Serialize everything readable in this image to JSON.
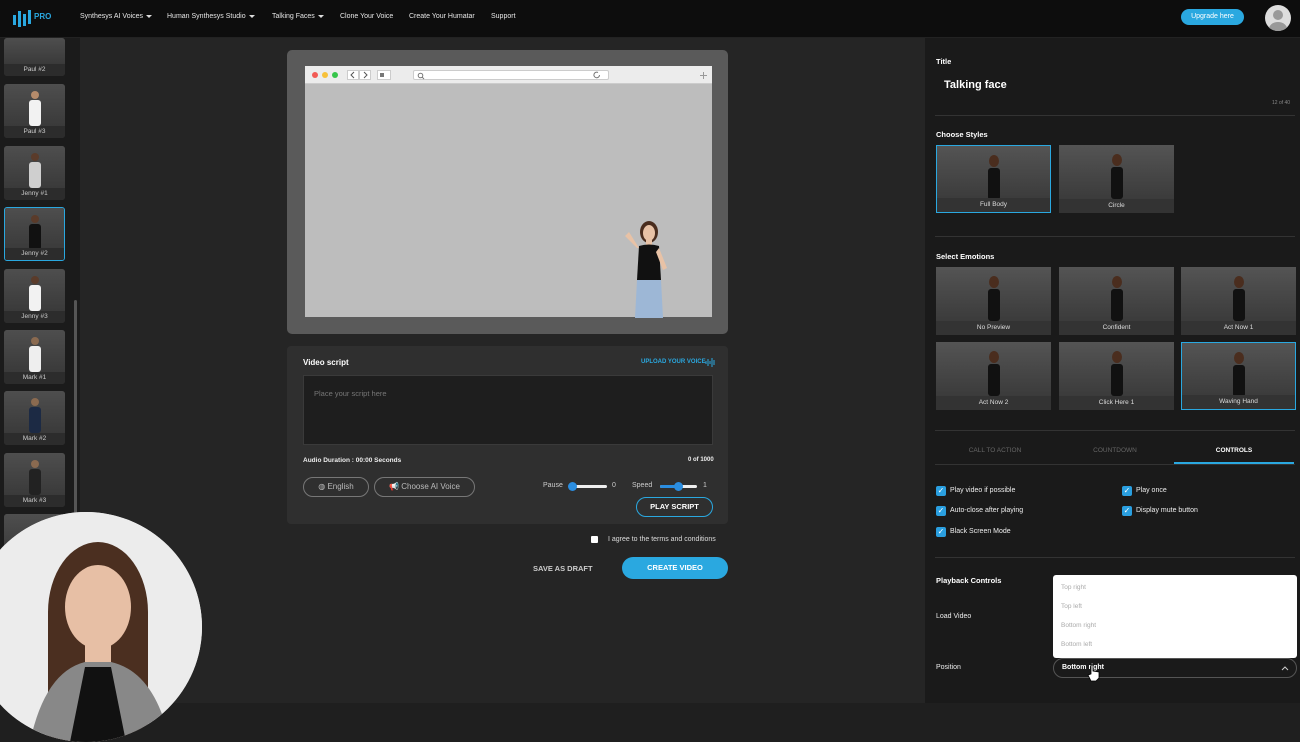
{
  "nav": {
    "logo_badge": "PRO",
    "items": [
      {
        "label": "Synthesys AI Voices",
        "caret": true
      },
      {
        "label": "Human Synthesys Studio",
        "caret": true
      },
      {
        "label": "Talking Faces",
        "caret": true
      },
      {
        "label": "Clone Your Voice",
        "caret": false
      },
      {
        "label": "Create Your Humatar",
        "caret": false
      },
      {
        "label": "Support",
        "caret": false
      }
    ],
    "upgrade_label": "Upgrade here"
  },
  "avatars": [
    {
      "label": "Paul #2"
    },
    {
      "label": "Paul #3"
    },
    {
      "label": "Jenny #1"
    },
    {
      "label": "Jenny #2",
      "selected": true
    },
    {
      "label": "Jenny #3"
    },
    {
      "label": "Mark #1"
    },
    {
      "label": "Mark #2"
    },
    {
      "label": "Mark #3"
    }
  ],
  "script": {
    "title": "Video script",
    "upload_label": "UPLOAD YOUR VOICE",
    "placeholder": "Place your script here",
    "duration": "Audio Duration : 00:00 Seconds",
    "char_count": "0 of 1000",
    "language": "English",
    "voice_button": "Choose AI Voice",
    "pause_label": "Pause",
    "pause_value": "0",
    "speed_label": "Speed",
    "speed_value": "1",
    "play_label": "PLAY SCRIPT"
  },
  "footer": {
    "terms": "I agree to the terms and conditions",
    "draft": "SAVE AS DRAFT",
    "create": "CREATE VIDEO"
  },
  "right": {
    "title_label": "Title",
    "title_value": "Talking face",
    "title_count": "12 of 40",
    "styles_label": "Choose Styles",
    "styles": [
      {
        "label": "Full Body",
        "selected": true
      },
      {
        "label": "Circle",
        "selected": false
      }
    ],
    "emotions_label": "Select Emotions",
    "emotions": [
      {
        "label": "No Preview",
        "selected": false
      },
      {
        "label": "Confident",
        "selected": false
      },
      {
        "label": "Act Now 1",
        "selected": false
      },
      {
        "label": "Act Now 2",
        "selected": false
      },
      {
        "label": "Click Here 1",
        "selected": false
      },
      {
        "label": "Waving Hand",
        "selected": true
      }
    ],
    "tabs": [
      "CALL TO ACTION",
      "COUNTDOWN",
      "CONTROLS"
    ],
    "active_tab": "CONTROLS",
    "controls": [
      {
        "label": "Play video if possible",
        "checked": true
      },
      {
        "label": "Play once",
        "checked": true
      },
      {
        "label": "Auto-close after playing",
        "checked": true
      },
      {
        "label": "Display mute button",
        "checked": true
      },
      {
        "label": "Black Screen Mode",
        "checked": true
      }
    ],
    "playback_label": "Playback Controls",
    "load_video_label": "Load Video",
    "position_label": "Position",
    "position_options": [
      "Top right",
      "Top left",
      "Bottom right",
      "Bottom left"
    ],
    "position_value": "Bottom right"
  },
  "colors": {
    "accent": "#2aa8e0",
    "background": "#1f1f1f"
  }
}
